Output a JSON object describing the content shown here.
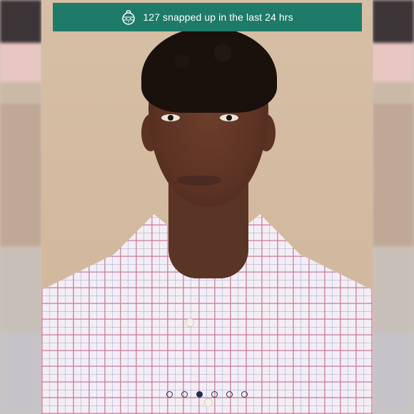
{
  "banner": {
    "text": "127 snapped up in the last 24 hrs",
    "icon": "ornament-icon",
    "background": "#1e7a69",
    "text_color": "#ffffff"
  },
  "image": {
    "subject": "man-wearing-checked-shirt"
  },
  "carousel": {
    "total": 6,
    "active_index": 2,
    "dot_color": "#1e2d55"
  },
  "side_bands": {
    "left": [
      "#3b3537",
      "#e8c6c2",
      "#cbb9a7",
      "#bfa996",
      "#c9bfb9",
      "#c5c3c8"
    ],
    "right": [
      "#3b3537",
      "#e8c6c2",
      "#cbb9a7",
      "#bfa996",
      "#c9bfb9",
      "#c5c3c8"
    ]
  }
}
